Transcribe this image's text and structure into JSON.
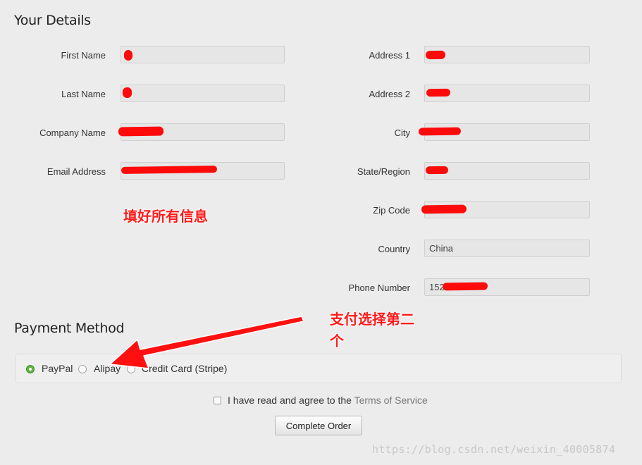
{
  "details": {
    "heading": "Your Details",
    "left_fields": [
      {
        "label": "First Name",
        "value": ""
      },
      {
        "label": "Last Name",
        "value": ""
      },
      {
        "label": "Company Name",
        "value": ""
      },
      {
        "label": "Email Address",
        "value": ""
      }
    ],
    "right_fields": [
      {
        "label": "Address 1",
        "value": ""
      },
      {
        "label": "Address 2",
        "value": ""
      },
      {
        "label": "City",
        "value": ""
      },
      {
        "label": "State/Region",
        "value": ""
      },
      {
        "label": "Zip Code",
        "value": ""
      },
      {
        "label": "Country",
        "value": "China"
      },
      {
        "label": "Phone Number",
        "value": "1521"
      }
    ]
  },
  "annotations": {
    "fill_info": "填好所有信息",
    "choose_second_line1": "支付选择第二",
    "choose_second_line2": "个",
    "color": "#ff1a1a"
  },
  "payment": {
    "heading": "Payment Method",
    "options": [
      {
        "label": "PayPal",
        "checked": true
      },
      {
        "label": "Alipay",
        "checked": false
      },
      {
        "label": "Credit Card (Stripe)",
        "checked": false
      }
    ],
    "accent": "#62b547"
  },
  "agreement": {
    "text": "I have read and agree to the",
    "link": "Terms of Service",
    "checked": false
  },
  "complete_button": "Complete Order",
  "watermark": "https://blog.csdn.net/weixin_40005874"
}
